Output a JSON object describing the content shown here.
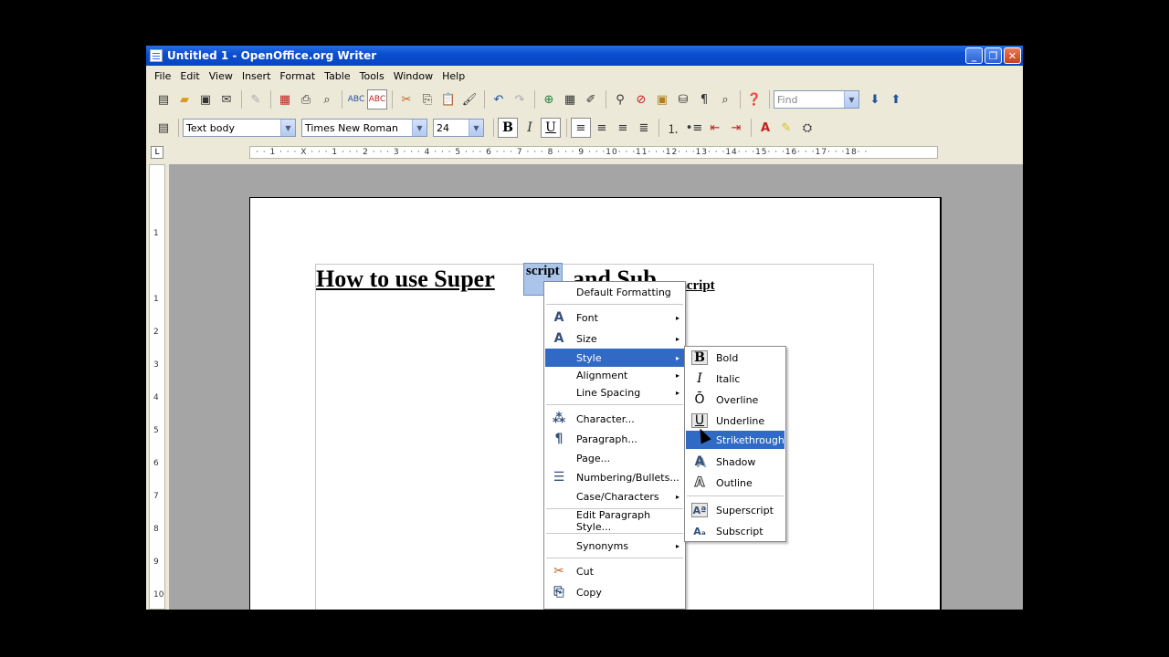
{
  "window": {
    "title": "Untitled 1 - OpenOffice.org Writer",
    "min": "_",
    "restore": "❐",
    "close": "✕"
  },
  "menus": [
    "File",
    "Edit",
    "View",
    "Insert",
    "Format",
    "Table",
    "Tools",
    "Window",
    "Help"
  ],
  "toolbar": {
    "find_placeholder": "Find"
  },
  "formatting": {
    "paragraph_style": "Text body",
    "font_name": "Times New Roman",
    "font_size": "24",
    "bold": "B",
    "italic": "I",
    "underline": "U"
  },
  "ruler": {
    "corner": "L",
    "marks": "· · 1 · · · X · · · 1 · · · 2 · · · 3 · · · 4 · · · 5 · · · 6 · · · 7 · · · 8 · · · 9 · · ·10· · ·11· · ·12· · ·13· · ·14· · ·15· · ·16· · ·17· · ·18· ·",
    "vertical": [
      "1",
      "1",
      "2",
      "3",
      "4",
      "5",
      "6",
      "7",
      "8",
      "9",
      "10"
    ]
  },
  "document": {
    "heading_part1": "How to use Super",
    "superscript_text": "script",
    "heading_part2": " and Sub",
    "subscript_text": "script"
  },
  "context_menu": {
    "items": [
      {
        "label": "Default Formatting",
        "icon": "",
        "arrow": ""
      },
      {
        "label": "Font",
        "icon": "A",
        "arrow": "▸"
      },
      {
        "label": "Size",
        "icon": "A",
        "arrow": "▸"
      },
      {
        "label": "Style",
        "icon": "",
        "arrow": "▸"
      },
      {
        "label": "Alignment",
        "icon": "",
        "arrow": "▸"
      },
      {
        "label": "Line Spacing",
        "icon": "",
        "arrow": "▸"
      },
      {
        "label": "Character...",
        "icon": "⁂",
        "arrow": ""
      },
      {
        "label": "Paragraph...",
        "icon": "¶",
        "arrow": ""
      },
      {
        "label": "Page...",
        "icon": "",
        "arrow": ""
      },
      {
        "label": "Numbering/Bullets...",
        "icon": "☰",
        "arrow": ""
      },
      {
        "label": "Case/Characters",
        "icon": "",
        "arrow": "▸"
      },
      {
        "label": "Edit Paragraph Style...",
        "icon": "",
        "arrow": ""
      },
      {
        "label": "Synonyms",
        "icon": "",
        "arrow": "▸"
      },
      {
        "label": "Cut",
        "icon": "✂",
        "arrow": ""
      },
      {
        "label": "Copy",
        "icon": "⎘",
        "arrow": ""
      }
    ]
  },
  "style_submenu": {
    "items": [
      {
        "label": "Bold",
        "icon": "B"
      },
      {
        "label": "Italic",
        "icon": "I"
      },
      {
        "label": "Overline",
        "icon": "Ō"
      },
      {
        "label": "Underline",
        "icon": "U"
      },
      {
        "label": "Strikethrough",
        "icon": ""
      },
      {
        "label": "Shadow",
        "icon": "A"
      },
      {
        "label": "Outline",
        "icon": "A"
      },
      {
        "label": "Superscript",
        "icon": "Aª"
      },
      {
        "label": "Subscript",
        "icon": "Aₐ"
      }
    ]
  }
}
